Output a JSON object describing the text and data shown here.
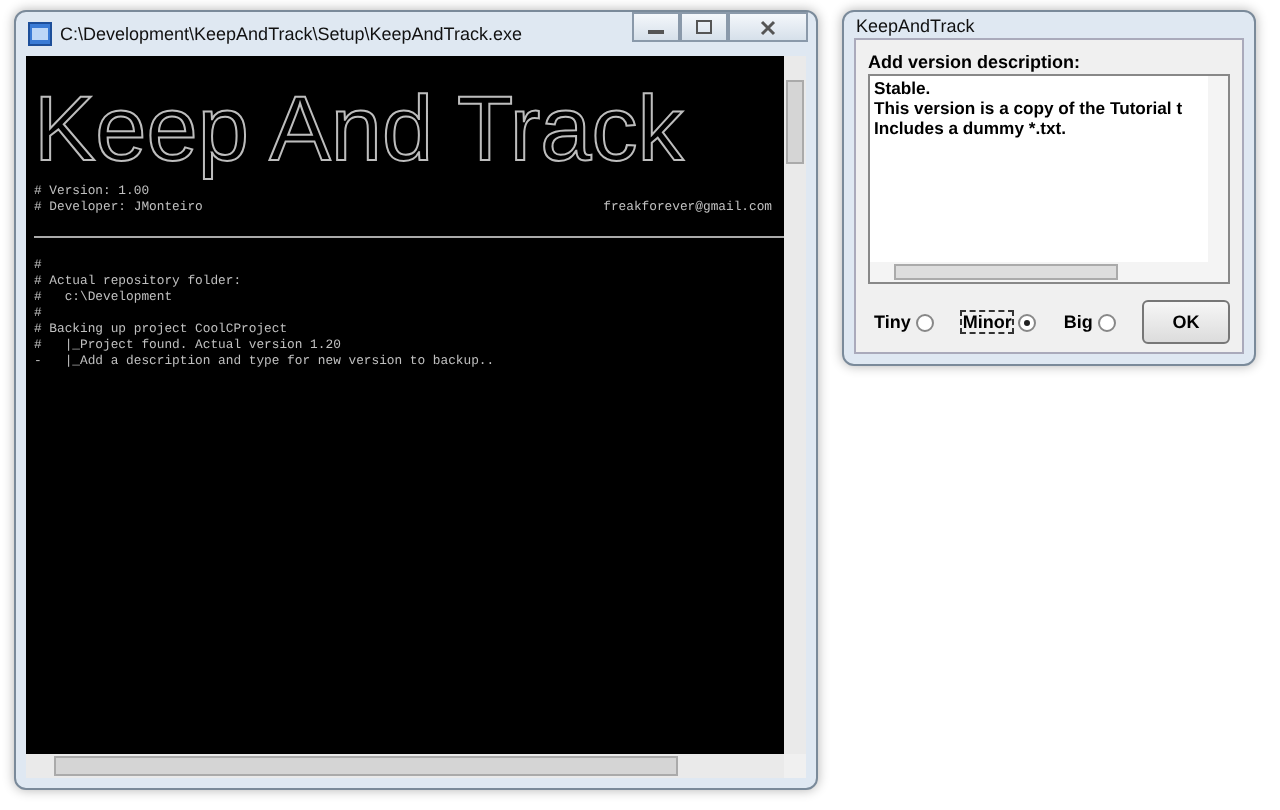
{
  "console_window": {
    "title": "C:\\Development\\KeepAndTrack\\Setup\\KeepAndTrack.exe",
    "banner": "Keep And Track",
    "info_lines": [
      {
        "left": "# Version: 1.00"
      },
      {
        "left": "# Developer: JMonteiro",
        "right": "freakforever@gmail.com"
      }
    ],
    "lines": [
      "#",
      "# Actual repository folder:",
      "#   c:\\Development",
      "#",
      "# Backing up project CoolCProject",
      "#   |_Project found. Actual version 1.20",
      "-   |_Add a description and type for new version to backup.."
    ]
  },
  "dialog": {
    "title": "KeepAndTrack",
    "label": "Add version description:",
    "description_lines": [
      "Stable.",
      "This version is a copy of the Tutorial t",
      "Includes a dummy *.txt."
    ],
    "options": [
      {
        "label": "Tiny",
        "selected": false
      },
      {
        "label": "Minor",
        "selected": true
      },
      {
        "label": "Big",
        "selected": false
      }
    ],
    "ok_button": "OK"
  }
}
